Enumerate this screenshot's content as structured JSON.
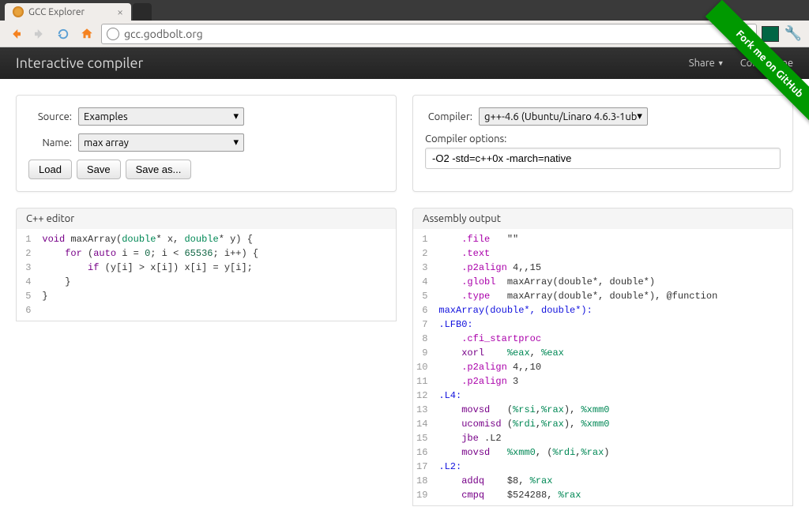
{
  "browser": {
    "tab_title": "GCC Explorer",
    "url": "gcc.godbolt.org"
  },
  "navbar": {
    "brand": "Interactive compiler",
    "share": "Share",
    "contact": "Contact me"
  },
  "ribbon": "Fork me on GitHub",
  "left_panel": {
    "source_label": "Source:",
    "source_value": "Examples",
    "name_label": "Name:",
    "name_value": "max array",
    "load_btn": "Load",
    "save_btn": "Save",
    "saveas_btn": "Save as..."
  },
  "right_panel": {
    "compiler_label": "Compiler:",
    "compiler_value": "g++-4.6 (Ubuntu/Linaro 4.6.3-1ub",
    "options_label": "Compiler options:",
    "options_value": "-O2 -std=c++0x -march=native"
  },
  "cpp_header": "C++ editor",
  "asm_header": "Assembly output",
  "cpp_code": [
    {
      "n": 1,
      "tokens": [
        [
          "kw",
          "void"
        ],
        [
          "op",
          " maxArray("
        ],
        [
          "type",
          "double"
        ],
        [
          "op",
          "* x, "
        ],
        [
          "type",
          "double"
        ],
        [
          "op",
          "* y) {"
        ]
      ]
    },
    {
      "n": 2,
      "tokens": [
        [
          "op",
          "    "
        ],
        [
          "kw",
          "for"
        ],
        [
          "op",
          " ("
        ],
        [
          "kw",
          "auto"
        ],
        [
          "op",
          " i = "
        ],
        [
          "num",
          "0"
        ],
        [
          "op",
          "; i < "
        ],
        [
          "num",
          "65536"
        ],
        [
          "op",
          "; i++) {"
        ]
      ]
    },
    {
      "n": 3,
      "tokens": [
        [
          "op",
          "        "
        ],
        [
          "kw",
          "if"
        ],
        [
          "op",
          " (y[i] > x[i]) x[i] = y[i];"
        ]
      ]
    },
    {
      "n": 4,
      "tokens": [
        [
          "op",
          "    }"
        ]
      ]
    },
    {
      "n": 5,
      "tokens": [
        [
          "op",
          "}"
        ]
      ]
    },
    {
      "n": 6,
      "tokens": [
        [
          "op",
          ""
        ]
      ]
    }
  ],
  "asm_code": [
    {
      "n": 1,
      "tokens": [
        [
          "op",
          "    "
        ],
        [
          "dir",
          ".file"
        ],
        [
          "op",
          "   \"\""
        ]
      ]
    },
    {
      "n": 2,
      "tokens": [
        [
          "op",
          "    "
        ],
        [
          "dir",
          ".text"
        ]
      ]
    },
    {
      "n": 3,
      "tokens": [
        [
          "op",
          "    "
        ],
        [
          "dir",
          ".p2align"
        ],
        [
          "op",
          " 4,,15"
        ]
      ]
    },
    {
      "n": 4,
      "tokens": [
        [
          "op",
          "    "
        ],
        [
          "dir",
          ".globl"
        ],
        [
          "op",
          "  maxArray(double*, double*)"
        ]
      ]
    },
    {
      "n": 5,
      "tokens": [
        [
          "op",
          "    "
        ],
        [
          "dir",
          ".type"
        ],
        [
          "op",
          "   maxArray(double*, double*), @function"
        ]
      ]
    },
    {
      "n": 6,
      "tokens": [
        [
          "lbl",
          "maxArray(double*, double*):"
        ]
      ]
    },
    {
      "n": 7,
      "tokens": [
        [
          "lbl",
          ".LFB0:"
        ]
      ]
    },
    {
      "n": 8,
      "tokens": [
        [
          "op",
          "    "
        ],
        [
          "dir",
          ".cfi_startproc"
        ]
      ]
    },
    {
      "n": 9,
      "tokens": [
        [
          "op",
          "    "
        ],
        [
          "kw",
          "xorl"
        ],
        [
          "op",
          "    "
        ],
        [
          "reg",
          "%eax"
        ],
        [
          "op",
          ", "
        ],
        [
          "reg",
          "%eax"
        ]
      ]
    },
    {
      "n": 10,
      "tokens": [
        [
          "op",
          "    "
        ],
        [
          "dir",
          ".p2align"
        ],
        [
          "op",
          " 4,,10"
        ]
      ]
    },
    {
      "n": 11,
      "tokens": [
        [
          "op",
          "    "
        ],
        [
          "dir",
          ".p2align"
        ],
        [
          "op",
          " 3"
        ]
      ]
    },
    {
      "n": 12,
      "tokens": [
        [
          "lbl",
          ".L4:"
        ]
      ]
    },
    {
      "n": 13,
      "tokens": [
        [
          "op",
          "    "
        ],
        [
          "kw",
          "movsd"
        ],
        [
          "op",
          "   ("
        ],
        [
          "reg",
          "%rsi"
        ],
        [
          "op",
          ","
        ],
        [
          "reg",
          "%rax"
        ],
        [
          "op",
          "), "
        ],
        [
          "reg",
          "%xmm0"
        ]
      ]
    },
    {
      "n": 14,
      "tokens": [
        [
          "op",
          "    "
        ],
        [
          "kw",
          "ucomisd"
        ],
        [
          "op",
          " ("
        ],
        [
          "reg",
          "%rdi"
        ],
        [
          "op",
          ","
        ],
        [
          "reg",
          "%rax"
        ],
        [
          "op",
          "), "
        ],
        [
          "reg",
          "%xmm0"
        ]
      ]
    },
    {
      "n": 15,
      "tokens": [
        [
          "op",
          "    "
        ],
        [
          "kw",
          "jbe"
        ],
        [
          "op",
          " .L2"
        ]
      ]
    },
    {
      "n": 16,
      "tokens": [
        [
          "op",
          "    "
        ],
        [
          "kw",
          "movsd"
        ],
        [
          "op",
          "   "
        ],
        [
          "reg",
          "%xmm0"
        ],
        [
          "op",
          ", ("
        ],
        [
          "reg",
          "%rdi"
        ],
        [
          "op",
          ","
        ],
        [
          "reg",
          "%rax"
        ],
        [
          "op",
          ")"
        ]
      ]
    },
    {
      "n": 17,
      "tokens": [
        [
          "lbl",
          ".L2:"
        ]
      ]
    },
    {
      "n": 18,
      "tokens": [
        [
          "op",
          "    "
        ],
        [
          "kw",
          "addq"
        ],
        [
          "op",
          "    $8, "
        ],
        [
          "reg",
          "%rax"
        ]
      ]
    },
    {
      "n": 19,
      "tokens": [
        [
          "op",
          "    "
        ],
        [
          "kw",
          "cmpq"
        ],
        [
          "op",
          "    $524288, "
        ],
        [
          "reg",
          "%rax"
        ]
      ]
    }
  ]
}
